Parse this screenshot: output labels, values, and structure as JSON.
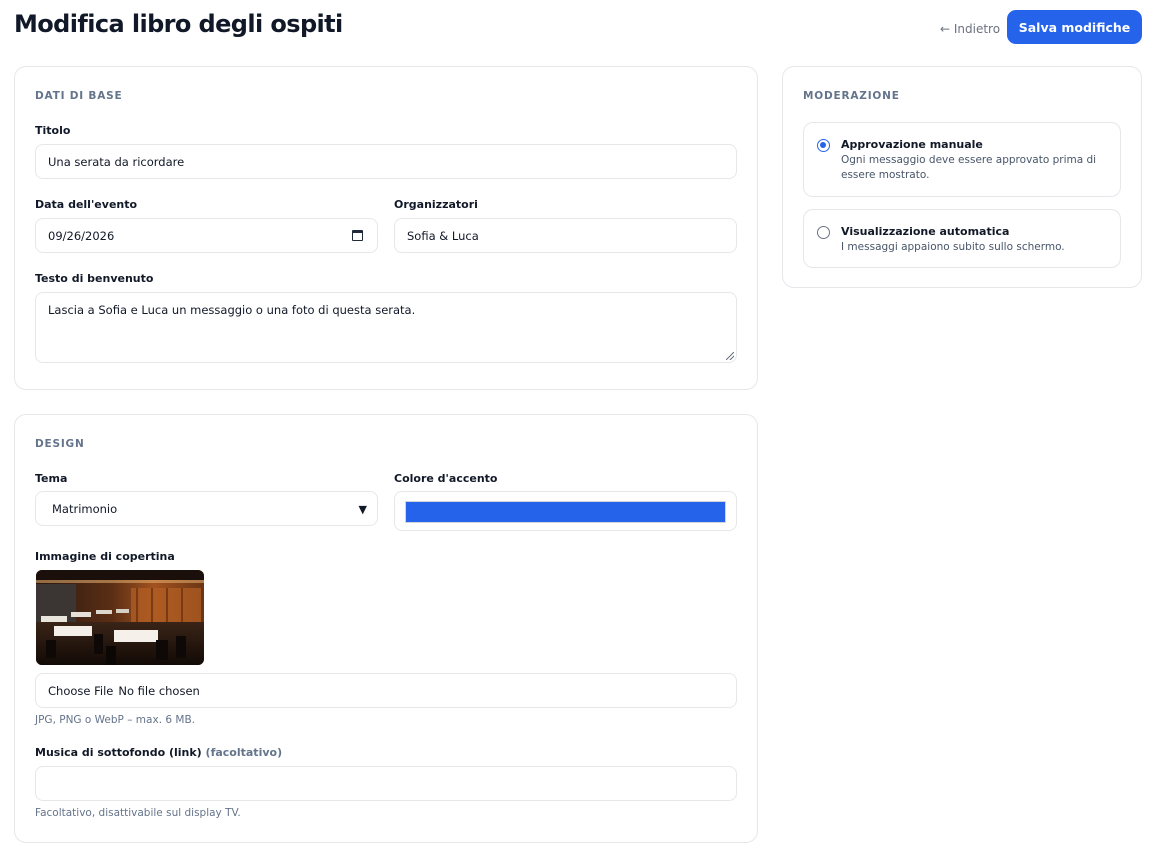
{
  "header": {
    "title": "Modifica libro degli ospiti",
    "back_label": "← Indietro",
    "save_label": "Salva modifiche"
  },
  "basic": {
    "section_title": "DATI DI BASE",
    "title_label": "Titolo",
    "title_value": "Una serata da ricordare",
    "date_label": "Data dell'evento",
    "date_value": "09/26/2026",
    "organizers_label": "Organizzatori",
    "organizers_value": "Sofia & Luca",
    "welcome_label": "Testo di benvenuto",
    "welcome_value": "Lascia a Sofia e Luca un messaggio o una foto di questa serata."
  },
  "design": {
    "section_title": "DESIGN",
    "theme_label": "Tema",
    "theme_value": "Matrimonio",
    "accent_label": "Colore d'accento",
    "accent_color": "#2563eb",
    "cover_label": "Immagine di copertina",
    "file_button": "Choose File",
    "file_status": "No file chosen",
    "file_hint": "JPG, PNG o WebP – max. 6 MB.",
    "music_label": "Musica di sottofondo (link)",
    "music_optional": "(facoltativo)",
    "music_value": "",
    "music_hint": "Facoltativo, disattivabile sul display TV."
  },
  "moderation": {
    "section_title": "MODERAZIONE",
    "options": [
      {
        "title": "Approvazione manuale",
        "description": "Ogni messaggio deve essere approvato prima di essere mostrato.",
        "selected": true
      },
      {
        "title": "Visualizzazione automatica",
        "description": "I messaggi appaiono subito sullo schermo.",
        "selected": false
      }
    ]
  },
  "colors": {
    "primary": "#2563eb",
    "border": "#e5e7eb",
    "muted": "#64748b"
  },
  "icons": [
    "calendar-icon",
    "chevron-down-icon",
    "radio-selected-icon",
    "radio-unselected-icon"
  ]
}
